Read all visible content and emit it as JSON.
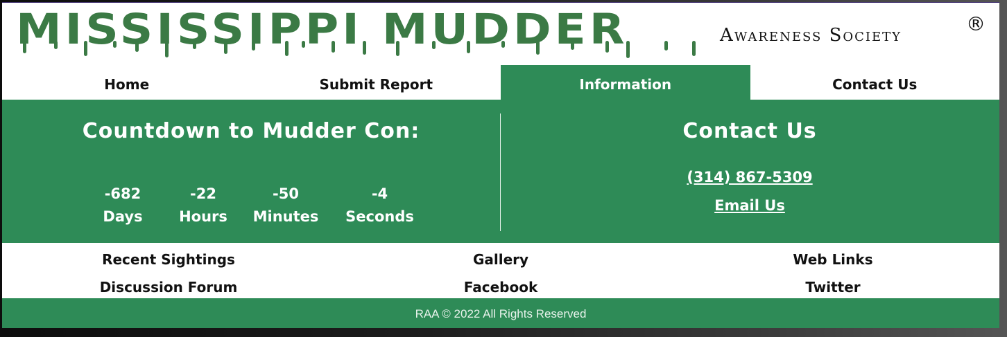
{
  "header": {
    "title": "MISSISSIPPI MUDDER",
    "subtitle": "Awareness Society",
    "registered_mark": "®"
  },
  "nav": {
    "items": [
      {
        "label": "Home",
        "active": false
      },
      {
        "label": "Submit Report",
        "active": false
      },
      {
        "label": "Information",
        "active": true
      },
      {
        "label": "Contact Us",
        "active": false
      }
    ]
  },
  "countdown": {
    "title": "Countdown to Mudder Con:",
    "units": [
      {
        "value": "-682",
        "label": "Days"
      },
      {
        "value": "-22",
        "label": "Hours"
      },
      {
        "value": "-50",
        "label": "Minutes"
      },
      {
        "value": "-4",
        "label": "Seconds"
      }
    ]
  },
  "contact": {
    "title": "Contact Us",
    "phone": "(314) 867-5309",
    "email_label": "Email Us"
  },
  "footer_links": {
    "col1": [
      "Recent Sightings",
      "Discussion Forum"
    ],
    "col2": [
      "Gallery",
      "Facebook"
    ],
    "col3": [
      "Web Links",
      "Twitter"
    ]
  },
  "footer": {
    "copyright": "RAA © 2022 All Rights Reserved"
  },
  "colors": {
    "brand_green": "#2e8b57",
    "logo_green": "#3b7a45"
  }
}
